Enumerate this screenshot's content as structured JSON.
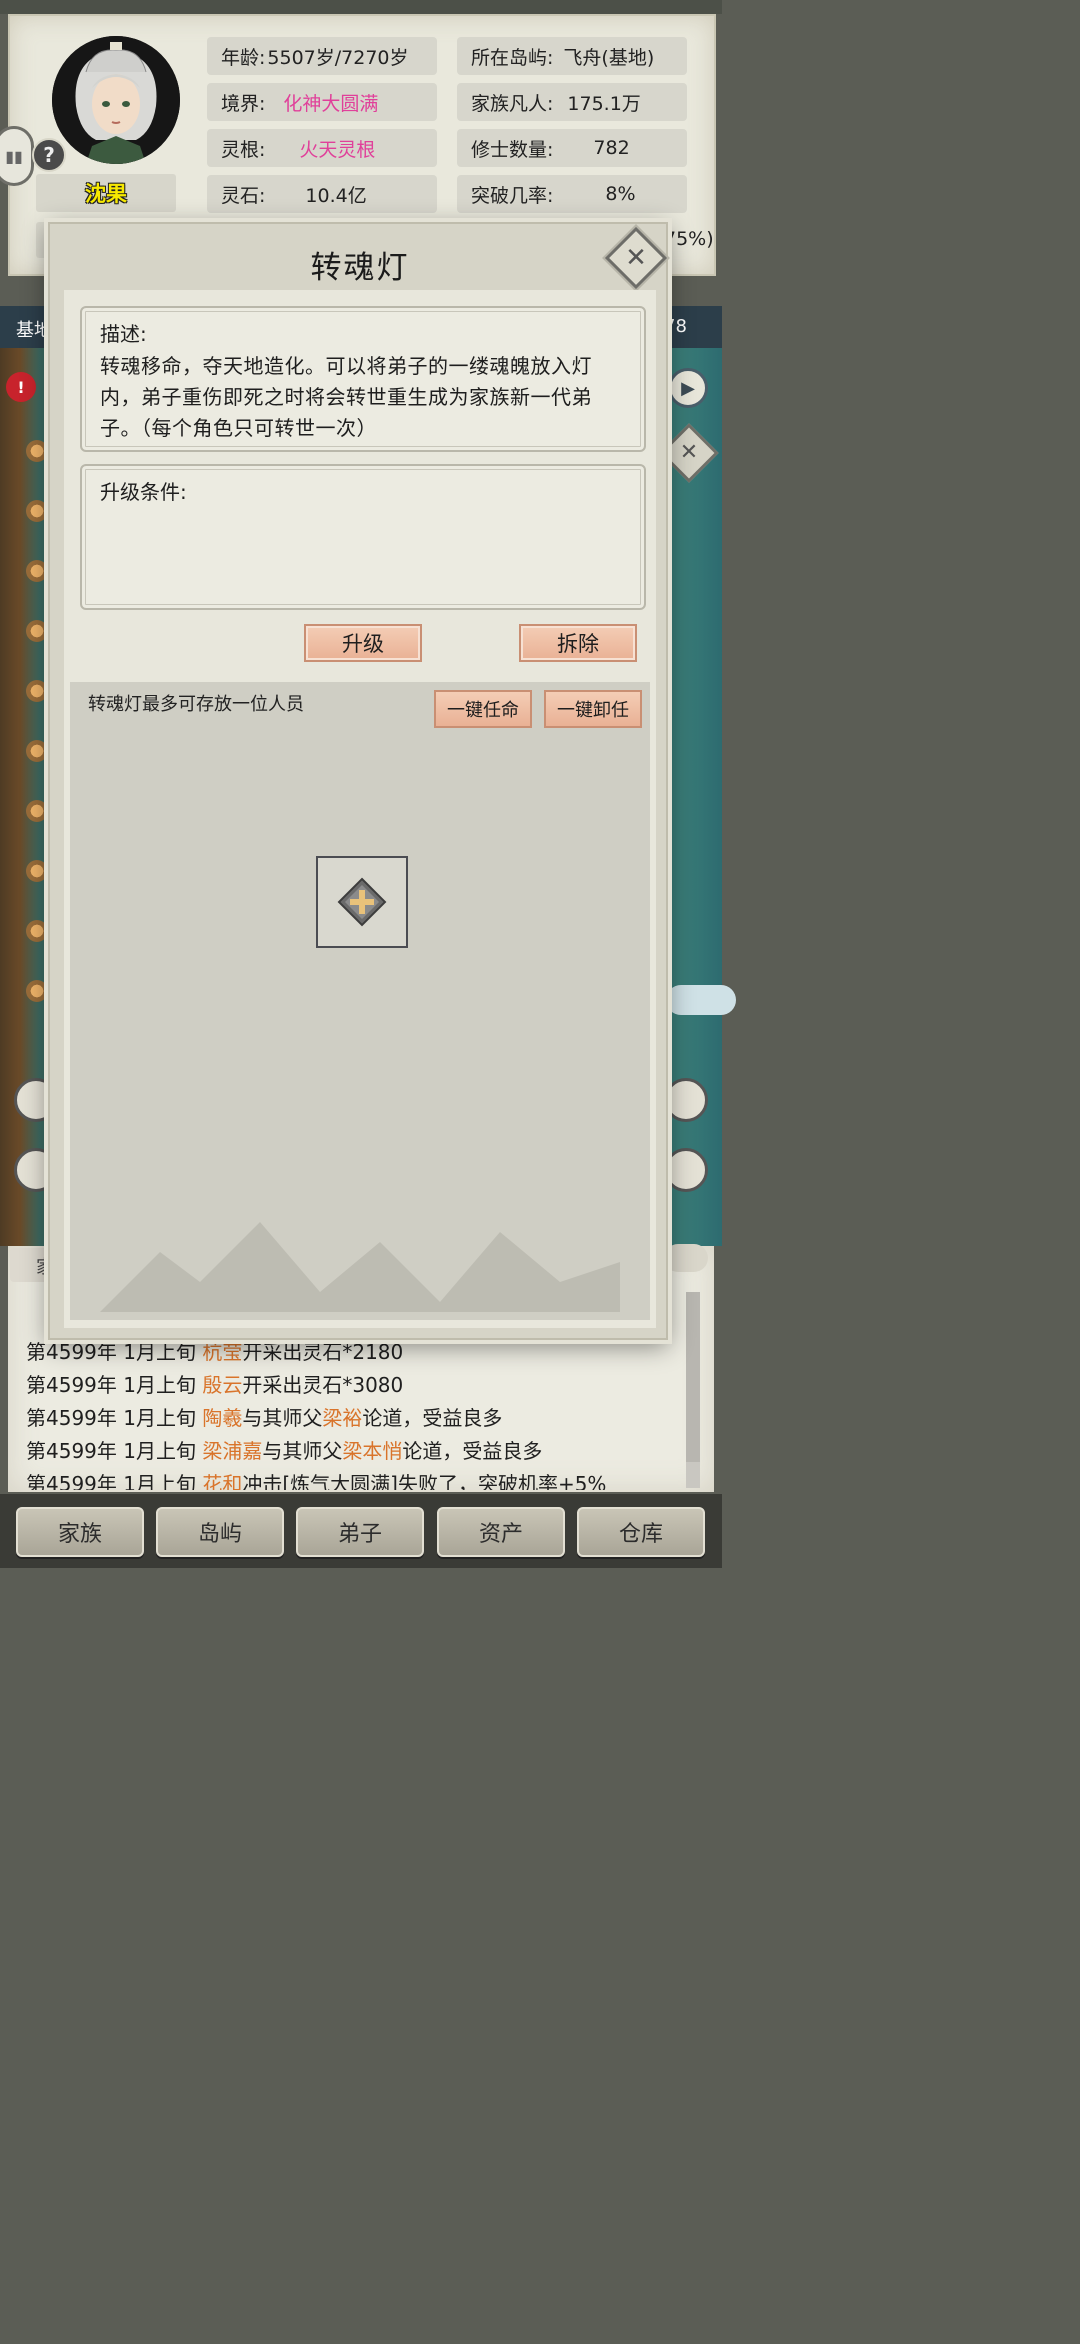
{
  "character": {
    "name": "沈果",
    "age_label": "年龄:",
    "age_value": "5507岁/7270岁",
    "realm_label": "境界:",
    "realm_value": "化神大圆满",
    "root_label": "灵根:",
    "root_value": "火天灵根",
    "stone_label": "灵石:",
    "stone_value": "10.4亿",
    "island_label": "所在岛屿:",
    "island_value": "飞舟(基地)",
    "mortal_label": "家族凡人:",
    "mortal_value": "175.1万",
    "cultivator_label": "修士数量:",
    "cultivator_value": "782",
    "breakthrough_label": "突破几率:",
    "breakthrough_value": "8%",
    "partial_value": "75%)"
  },
  "map": {
    "label_left": "基地",
    "label_right": "78"
  },
  "dialog": {
    "title": "转魂灯",
    "desc_label": "描述:",
    "desc_text": "转魂移命，夺天地造化。可以将弟子的一缕魂魄放入灯内，弟子重伤即死之时将会转世重生成为家族新一代弟子。（每个角色只可转世一次）",
    "upgrade_label": "升级条件:",
    "upgrade_button": "升级",
    "demolish_button": "拆除",
    "slot_caption": "转魂灯最多可存放一位人员",
    "appoint_button": "一键任命",
    "dismiss_button": "一键卸任"
  },
  "log": {
    "tab_label": "家",
    "entries": [
      {
        "prefix": "第4599年 1月上旬 ",
        "name": "杭莹",
        "mid": "开采出灵石*2180",
        "name2": "",
        "tail": ""
      },
      {
        "prefix": "第4599年 1月上旬 ",
        "name": "殷云",
        "mid": "开采出灵石*3080",
        "name2": "",
        "tail": ""
      },
      {
        "prefix": "第4599年 1月上旬 ",
        "name": "陶羲",
        "mid": "与其师父",
        "name2": "梁裕",
        "tail": "论道，受益良多"
      },
      {
        "prefix": "第4599年 1月上旬 ",
        "name": "梁浦嘉",
        "mid": "与其师父",
        "name2": "梁本悄",
        "tail": "论道，受益良多"
      },
      {
        "prefix": "第4599年 1月上旬 ",
        "name": "花和",
        "mid": "冲击[炼气大圆满]失败了，突破机率+5%",
        "name2": "",
        "tail": ""
      }
    ]
  },
  "nav": {
    "family": "家族",
    "island": "岛屿",
    "disciple": "弟子",
    "assets": "资产",
    "warehouse": "仓库"
  },
  "colors": {
    "pink_highlight": "#e0409a",
    "name_highlight": "#d9742b",
    "button_peach": "#e9b195"
  }
}
